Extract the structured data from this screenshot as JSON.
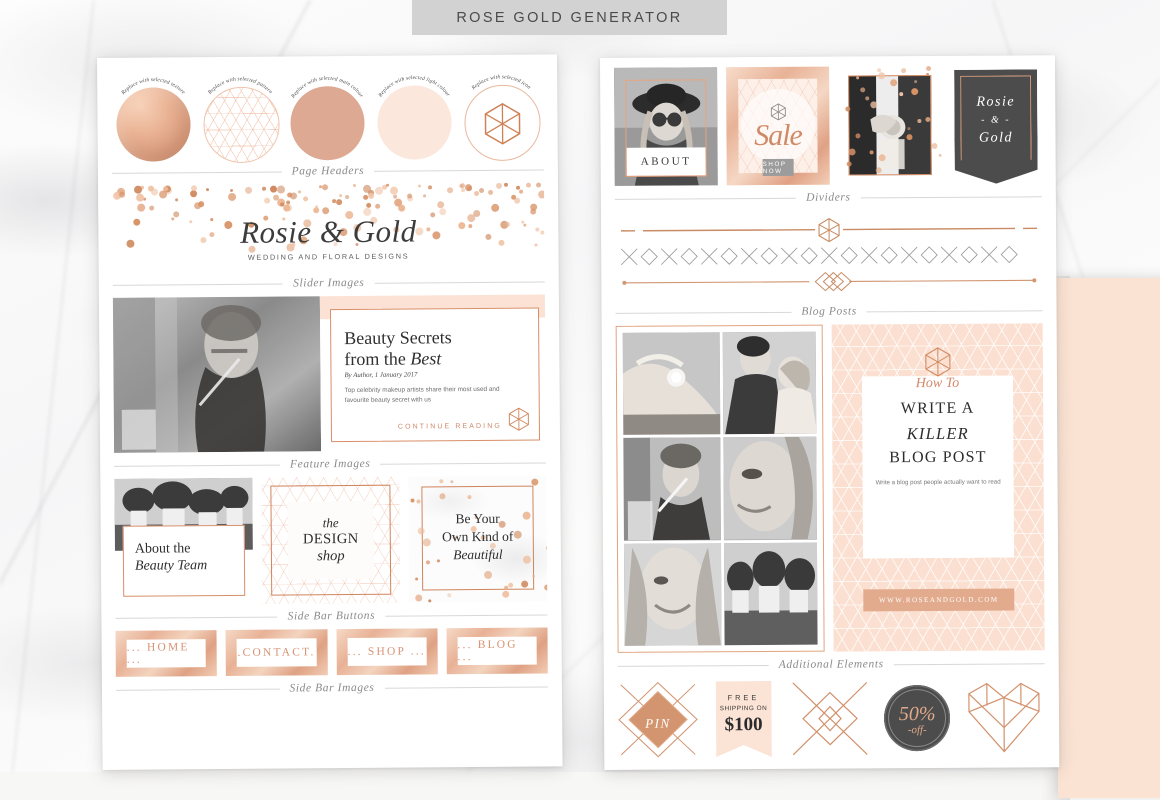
{
  "page": {
    "title": "ROSE GOLD GENERATOR",
    "accent_gold": "#d0845c",
    "accent_peach": "#fbe3d3",
    "dark": "#4c4c4c"
  },
  "left_panel": {
    "swatches": [
      {
        "label": "Replace with selected texture",
        "kind": "texture"
      },
      {
        "label": "Replace with selected pattern",
        "kind": "pattern"
      },
      {
        "label": "Replace with selected main colour",
        "kind": "main"
      },
      {
        "label": "Replace with selected light colour",
        "kind": "light"
      },
      {
        "label": "Replace with selected icon",
        "kind": "icon"
      }
    ],
    "sections": {
      "page_headers": "Page Headers",
      "slider_images": "Slider Images",
      "feature_images": "Feature Images",
      "sidebar_buttons": "Side Bar Buttons",
      "sidebar_images": "Side Bar Images"
    },
    "header_banner": {
      "title": "Rosie & Gold",
      "subtitle": "WEDDING AND FLORAL DESIGNS"
    },
    "slider": {
      "title_line1": "Beauty Secrets",
      "title_line2_plain": "from the ",
      "title_line2_italic": "Best",
      "byline": "By Author, 1 January 2017",
      "description": "Top celebrity makeup artists share their most used and favourite beauty secret with us",
      "cta": "CONTINUE READING"
    },
    "features": [
      {
        "line1": "About the",
        "line2": "Beauty Team"
      },
      {
        "line1": "the",
        "line2": "DESIGN",
        "line3": "shop"
      },
      {
        "line1": "Be Your",
        "line2": "Own Kind of",
        "line3": "Beautiful"
      }
    ],
    "sidebar_buttons": [
      "... HOME ...",
      ".CONTACT.",
      "... SHOP ...",
      "... BLOG ..."
    ]
  },
  "right_panel": {
    "sections": {
      "dividers": "Dividers",
      "blog_posts": "Blog Posts",
      "additional_elements": "Additional Elements"
    },
    "top_row": {
      "about_label": "ABOUT",
      "sale_label": "Sale",
      "shop_now": "SHOP NOW",
      "banner_line1": "Rosie",
      "banner_line2": "- & -",
      "banner_line3": "Gold"
    },
    "blog_card": {
      "eyebrow": "How To",
      "line1": "WRITE A",
      "line2": "KILLER",
      "line3": "BLOG POST",
      "subtitle": "Write a blog post people actually want to read",
      "url": "WWW.ROSEANDGOLD.COM"
    },
    "additional_elements": [
      {
        "name": "pin-badge",
        "label": "PIN"
      },
      {
        "name": "free-shipping-badge",
        "line1": "FREE",
        "line2": "SHIPPING ON",
        "price": "$100"
      },
      {
        "name": "geometric-diamond-icon",
        "label": ""
      },
      {
        "name": "discount-badge",
        "number": "50%",
        "label": "-off-"
      },
      {
        "name": "geometric-heart-icon",
        "label": ""
      }
    ]
  }
}
